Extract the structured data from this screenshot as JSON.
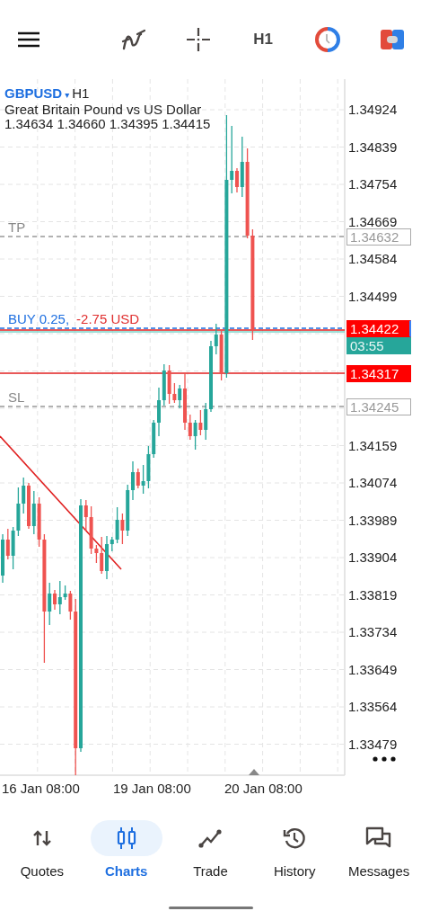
{
  "toolbar": {
    "timeframe": "H1"
  },
  "chart": {
    "symbol": "GBPUSD",
    "dropdown": "▾",
    "timeframe": "H1",
    "description": "Great Britain Pound vs US Dollar",
    "ohlc": "1.34634 1.34660 1.34395 1.34415",
    "levels": [
      {
        "kind": "tp",
        "label": "TP",
        "price": "1.34632"
      },
      {
        "kind": "position",
        "label": "BUY 0.25,",
        "profit": "-2.75 USD",
        "price": "1.34422",
        "timer": "03:55"
      },
      {
        "kind": "pending",
        "price": "1.34317"
      },
      {
        "kind": "sl",
        "label": "SL",
        "price": "1.34245"
      }
    ],
    "price_axis": [
      "1.34924",
      "1.34839",
      "1.34754",
      "1.34669",
      "1.34584",
      "1.34499",
      "1.34159",
      "1.34074",
      "1.33989",
      "1.33904",
      "1.33819",
      "1.33734",
      "1.33649",
      "1.33564",
      "1.33479"
    ],
    "time_axis": [
      "16 Jan 08:00",
      "19 Jan 08:00",
      "20 Jan 08:00"
    ]
  },
  "nav": [
    {
      "kind": "quotes",
      "label": "Quotes",
      "selected": false
    },
    {
      "kind": "charts",
      "label": "Charts",
      "selected": true
    },
    {
      "kind": "trade",
      "label": "Trade",
      "selected": false
    },
    {
      "kind": "history",
      "label": "History",
      "selected": false
    },
    {
      "kind": "messages",
      "label": "Messages",
      "selected": false
    }
  ]
}
